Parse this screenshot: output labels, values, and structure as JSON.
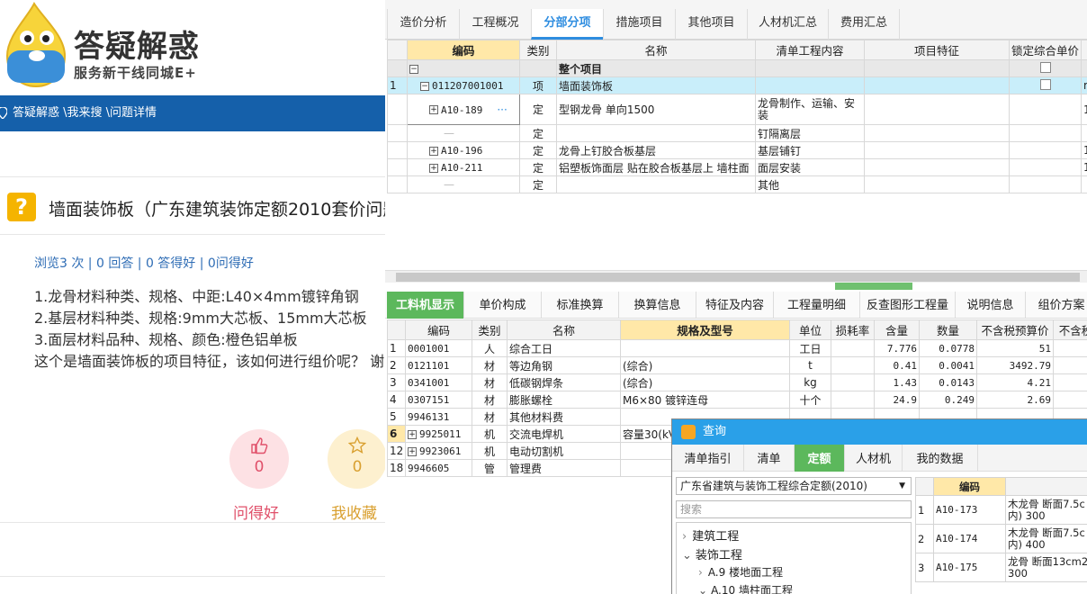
{
  "site": {
    "brand": "答疑解惑",
    "slogan": "服务新干线同城E+",
    "breadcrumb": "答疑解惑 \\我来搜 \\问题详情"
  },
  "question": {
    "title": "墙面装饰板（广东建筑装饰定额2010套价问题",
    "stats": "浏览3 次 | 0 回答 | 0 答得好 | 0问得好",
    "lines": [
      "1.龙骨材料种类、规格、中距:L40×4mm镀锌角钢",
      "2.基层材料种类、规格:9mm大芯板、15mm大芯板",
      "3.面层材料品种、规格、颜色:橙色铝单板",
      " 这个是墙面装饰板的项目特征，该如何进行组价呢？ 谢"
    ],
    "like_count": "0",
    "like_label": "问得好",
    "fav_count": "0",
    "fav_label": "我收藏"
  },
  "top_tabs": [
    "造价分析",
    "工程概况",
    "分部分项",
    "措施项目",
    "其他项目",
    "人材机汇总",
    "费用汇总"
  ],
  "upper_table": {
    "headers": [
      "编码",
      "类别",
      "名称",
      "清单工程内容",
      "项目特征",
      "锁定综合单价"
    ],
    "rows": [
      {
        "num": "",
        "code": "",
        "type": "",
        "name": "整个项目",
        "content": "",
        "feature": ""
      },
      {
        "num": "1",
        "code": "011207001001",
        "type": "项",
        "name": "墙面装饰板",
        "content": "",
        "feature": "",
        "extra": "m"
      },
      {
        "num": "",
        "code": "A10-189",
        "type": "定",
        "name": "型钢龙骨 单向1500",
        "content": "龙骨制作、运输、安装",
        "feature": "",
        "extra": "1"
      },
      {
        "num": "",
        "code": "",
        "type": "定",
        "name": "",
        "content": "钉隔离层",
        "feature": "",
        "extra": ""
      },
      {
        "num": "",
        "code": "A10-196",
        "type": "定",
        "name": "龙骨上钉胶合板基层",
        "content": "基层铺钉",
        "feature": "",
        "extra": "1"
      },
      {
        "num": "",
        "code": "A10-211",
        "type": "定",
        "name": "铝塑板饰面层 贴在胶合板基层上 墙柱面",
        "content": "面层安装",
        "feature": "",
        "extra": "1"
      },
      {
        "num": "",
        "code": "",
        "type": "定",
        "name": "",
        "content": "其他",
        "feature": "",
        "extra": ""
      }
    ]
  },
  "bottom_tabs": [
    "工料机显示",
    "单价构成",
    "标准换算",
    "换算信息",
    "特征及内容",
    "工程量明细",
    "反查图形工程量",
    "说明信息",
    "组价方案"
  ],
  "lower_table": {
    "headers": [
      "编码",
      "类别",
      "名称",
      "规格及型号",
      "单位",
      "损耗率",
      "含量",
      "数量",
      "不含税预算价",
      "不含税"
    ],
    "rows": [
      {
        "num": "1",
        "code": "0001001",
        "type": "人",
        "name": "综合工日",
        "spec": "",
        "unit": "工日",
        "qty": "7.776",
        "amount": "0.0778",
        "price": "51"
      },
      {
        "num": "2",
        "code": "0121101",
        "type": "材",
        "name": "等边角钢",
        "spec": "(综合)",
        "unit": "t",
        "qty": "0.41",
        "amount": "0.0041",
        "price": "3492.79"
      },
      {
        "num": "3",
        "code": "0341001",
        "type": "材",
        "name": "低碳钢焊条",
        "spec": "(综合)",
        "unit": "kg",
        "qty": "1.43",
        "amount": "0.0143",
        "price": "4.21"
      },
      {
        "num": "4",
        "code": "0307151",
        "type": "材",
        "name": "膨胀螺栓",
        "spec": "M6×80 镀锌连母",
        "unit": "十个",
        "qty": "24.9",
        "amount": "0.249",
        "price": "2.69"
      },
      {
        "num": "5",
        "code": "9946131",
        "type": "材",
        "name": "其他材料费",
        "spec": "",
        "unit": "",
        "qty": "",
        "amount": "",
        "price": ""
      },
      {
        "num": "6",
        "code": "9925011",
        "type": "机",
        "name": "交流电焊机",
        "spec": "容量30(kV",
        "unit": "",
        "qty": "",
        "amount": "",
        "price": ""
      },
      {
        "num": "12",
        "code": "9923061",
        "type": "机",
        "name": "电动切割机",
        "spec": "",
        "unit": "",
        "qty": "",
        "amount": "",
        "price": ""
      },
      {
        "num": "18",
        "code": "9946605",
        "type": "管",
        "name": "管理费",
        "spec": "",
        "unit": "",
        "qty": "",
        "amount": "",
        "price": ""
      }
    ]
  },
  "dialog": {
    "title": "查询",
    "tabs": [
      "清单指引",
      "清单",
      "定额",
      "人材机",
      "我的数据"
    ],
    "select_value": "广东省建筑与装饰工程综合定额(2010)",
    "search_placeholder": "搜索",
    "tree": [
      "建筑工程",
      "装饰工程",
      "A.9 楼地面工程",
      "A.10 墙柱面工程"
    ],
    "grid_header": "编码",
    "grid_rows": [
      {
        "num": "1",
        "code": "A10-173",
        "name": "木龙骨 断面7.5c",
        "name2": "内) 300"
      },
      {
        "num": "2",
        "code": "A10-174",
        "name": "木龙骨 断面7.5c",
        "name2": "内) 400"
      },
      {
        "num": "3",
        "code": "A10-175",
        "name": "龙骨 断面13cm2内",
        "name2": "300"
      }
    ]
  }
}
